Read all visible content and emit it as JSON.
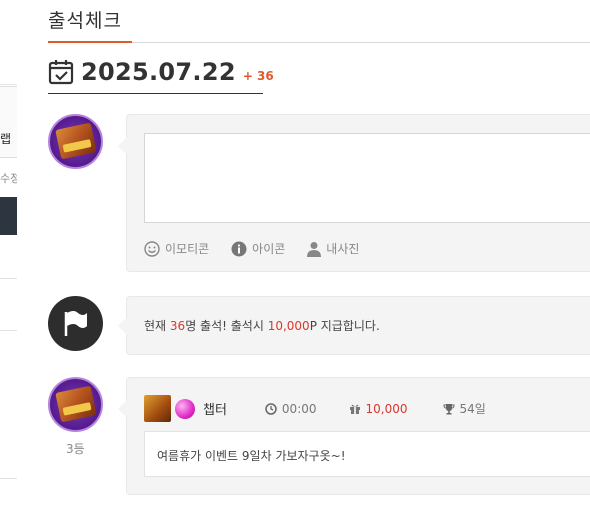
{
  "sidebar": {
    "partial_label_1": "랩",
    "partial_label_2": "수정"
  },
  "header": {
    "title": "출석체크",
    "date": "2025.07.22",
    "count": "+ 36"
  },
  "composer": {
    "tools": [
      {
        "icon": "smile-icon",
        "label": "이모티콘"
      },
      {
        "icon": "info-icon",
        "label": "아이콘"
      },
      {
        "icon": "user-icon",
        "label": "내사진"
      }
    ]
  },
  "notice": {
    "prefix": "현재 ",
    "attendee_count": "36",
    "middle": "명 출석! 출석시 ",
    "point_amount": "10,000",
    "suffix": "P 지급합니다."
  },
  "entries": [
    {
      "rank": "3등",
      "nickname": "챕터",
      "time": "00:00",
      "points": "10,000",
      "streak": "54일",
      "message": "여름휴가 이벤트 9일차 가보자구옷~!"
    }
  ],
  "colors": {
    "accent": "#e05a2a",
    "highlight": "#d9382c",
    "box_bg": "#f4f4f4",
    "avatar_purple": "#5a1f93"
  }
}
